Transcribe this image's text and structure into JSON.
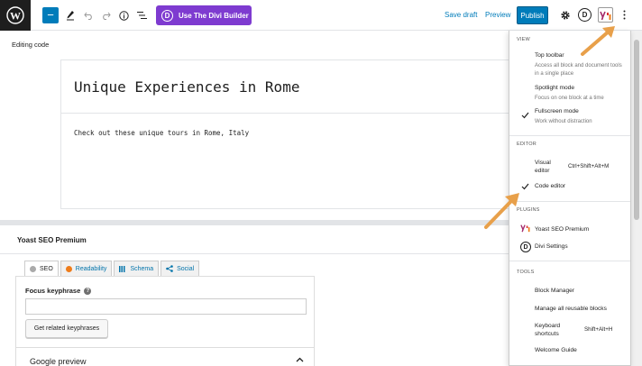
{
  "toolbar": {
    "add_icon": "plus-icon",
    "divi_builder_label": "Use The Divi Builder",
    "divi_logo_letter": "D",
    "save_draft_label": "Save draft",
    "preview_label": "Preview",
    "publish_label": "Publish",
    "divi_settings_letter": "D"
  },
  "editor": {
    "mode_label": "Editing code",
    "title_code": "Unique Experiences in Rome",
    "content_code": "Check out these unique tours in Rome, Italy"
  },
  "yoast": {
    "panel_title": "Yoast SEO Premium",
    "tabs": [
      {
        "label": "SEO"
      },
      {
        "label": "Readability"
      },
      {
        "label": "Schema"
      },
      {
        "label": "Social"
      }
    ],
    "focus_keyphrase_label": "Focus keyphrase",
    "help_glyph": "?",
    "focus_keyphrase_value": "",
    "related_button_label": "Get related keyphrases",
    "google_preview_label": "Google preview"
  },
  "menu": {
    "view_label": "View",
    "view_items": [
      {
        "label": "Top toolbar",
        "desc": "Access all block and document tools in a single place",
        "checked": false
      },
      {
        "label": "Spotlight mode",
        "desc": "Focus on one block at a time",
        "checked": false
      },
      {
        "label": "Fullscreen mode",
        "desc": "Work without distraction",
        "checked": true
      }
    ],
    "editor_label": "Editor",
    "visual_editor_label": "Visual editor",
    "visual_editor_shortcut": "Ctrl+Shift+Alt+M",
    "code_editor_label": "Code editor",
    "plugins_label": "Plugins",
    "plugin_yoast": "Yoast SEO Premium",
    "plugin_divi": "Divi Settings",
    "tools_label": "Tools",
    "block_manager": "Block Manager",
    "manage_reusable": "Manage all reusable blocks",
    "keyboard_shortcuts": "Keyboard shortcuts",
    "keyboard_shortcut_keys": "Shift+Alt+H",
    "welcome_guide": "Welcome Guide"
  },
  "colors": {
    "accent": "#007cba",
    "divi_purple": "#7e3bd0",
    "arrow_orange": "#e8a04a"
  }
}
